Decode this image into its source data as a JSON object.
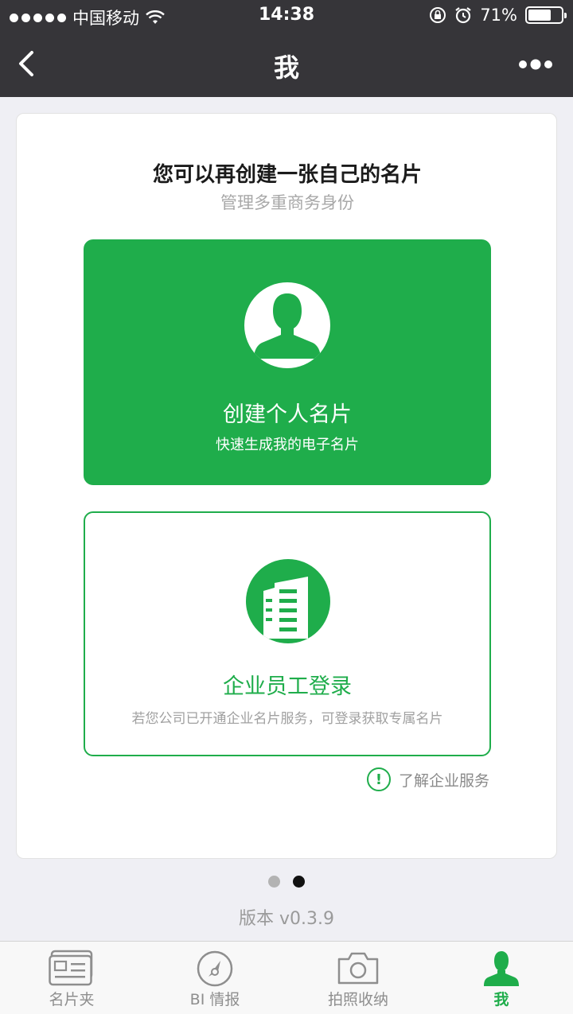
{
  "status_bar": {
    "carrier": "中国移动",
    "time": "14:38",
    "battery": "71%",
    "battery_level": 0.71
  },
  "nav": {
    "title": "我"
  },
  "card": {
    "headline": "您可以再创建一张自己的名片",
    "subline": "管理多重商务身份",
    "personal": {
      "label": "创建个人名片",
      "desc": "快速生成我的电子名片"
    },
    "enterprise": {
      "label": "企业员工登录",
      "desc": "若您公司已开通企业名片服务，可登录获取专属名片"
    },
    "learn_more": "了解企业服务"
  },
  "pager": {
    "current": 2,
    "total": 2
  },
  "version": "版本 v0.3.9",
  "tabbar": {
    "items": [
      {
        "label": "名片夹",
        "icon": "card-holder-icon"
      },
      {
        "label": "BI 情报",
        "icon": "gauge-icon"
      },
      {
        "label": "拍照收纳",
        "icon": "camera-icon"
      },
      {
        "label": "我",
        "icon": "person-icon"
      }
    ],
    "active_index": 3
  },
  "colors": {
    "brand_green": "#1fad4b",
    "nav_bg": "#363539"
  }
}
